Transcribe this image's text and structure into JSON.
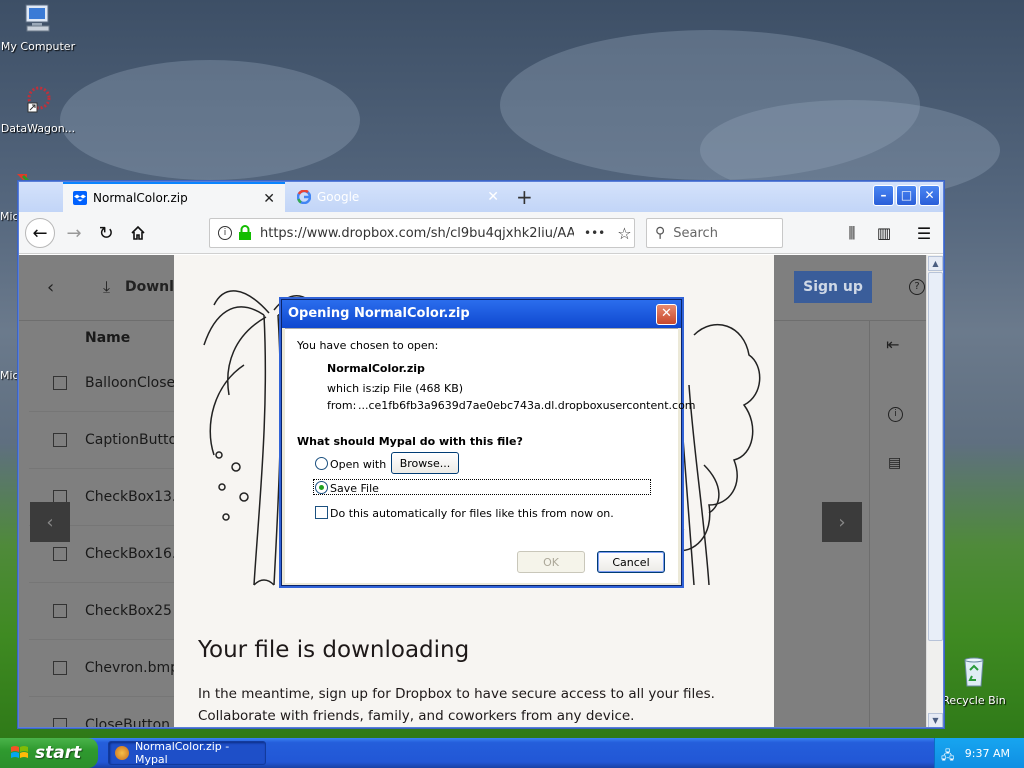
{
  "desktop": {
    "icons": [
      {
        "label": "My Computer"
      },
      {
        "label": "DataWagon..."
      },
      {
        "label": "Mic"
      },
      {
        "label": "Mic"
      },
      {
        "label": "Recycle Bin"
      }
    ]
  },
  "browser": {
    "tabs": [
      {
        "label": "NormalColor.zip",
        "active": true
      },
      {
        "label": "Google",
        "active": false
      }
    ],
    "new_tab": "+",
    "url": "https://www.dropbox.com/sh/cl9bu4qjxhk2liu/AA",
    "url_more": "•••",
    "search_placeholder": "Search"
  },
  "dropbox": {
    "download_label": "Downlo",
    "name_header": "Name",
    "files": [
      "BalloonClose",
      "CaptionButto",
      "CheckBox13.",
      "CheckBox16.",
      "CheckBox25",
      "Chevron.bmp",
      "CloseButton"
    ],
    "signup_label": "Sign up",
    "headline": "Your file is downloading",
    "paragraph": "In the meantime, sign up for Dropbox to have secure access to all your files. Collaborate with friends, family, and coworkers from any device."
  },
  "dialog": {
    "title": "Opening NormalColor.zip",
    "intro": "You have chosen to open:",
    "filename": "NormalColor.zip",
    "which_is_label": "which is:",
    "which_is_value": "zip File (468 KB)",
    "from_label": "from:",
    "from_value": "...ce1fb6fb3a9639d7ae0ebc743a.dl.dropboxusercontent.com",
    "question": "What should Mypal do with this file?",
    "open_with_label": "Open with",
    "browse_label": "Browse...",
    "save_file_label": "Save File",
    "auto_label": "Do this automatically for files like this from now on.",
    "ok_label": "OK",
    "cancel_label": "Cancel",
    "selected_option": "Save File"
  },
  "taskbar": {
    "start_label": "start",
    "task_label": "NormalColor.zip - Mypal",
    "clock": "9:37 AM"
  }
}
